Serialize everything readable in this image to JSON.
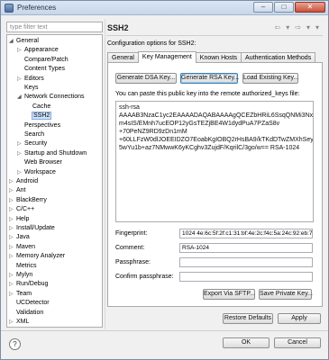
{
  "window": {
    "title": "Preferences",
    "controls": [
      "–",
      "□",
      "✕"
    ]
  },
  "filter": {
    "placeholder": "type filter text"
  },
  "tree": [
    {
      "label": "General",
      "toggle": "◢",
      "indent": 0
    },
    {
      "label": "Appearance",
      "toggle": "▷",
      "indent": 1
    },
    {
      "label": "Compare/Patch",
      "toggle": "",
      "indent": 1
    },
    {
      "label": "Content Types",
      "toggle": "",
      "indent": 1
    },
    {
      "label": "Editors",
      "toggle": "▷",
      "indent": 1
    },
    {
      "label": "Keys",
      "toggle": "",
      "indent": 1
    },
    {
      "label": "Network Connections",
      "toggle": "◢",
      "indent": 1
    },
    {
      "label": "Cache",
      "toggle": "",
      "indent": 2
    },
    {
      "label": "SSH2",
      "toggle": "",
      "indent": 2,
      "selected": true
    },
    {
      "label": "Perspectives",
      "toggle": "",
      "indent": 1
    },
    {
      "label": "Search",
      "toggle": "",
      "indent": 1
    },
    {
      "label": "Security",
      "toggle": "▷",
      "indent": 1
    },
    {
      "label": "Startup and Shutdown",
      "toggle": "▷",
      "indent": 1
    },
    {
      "label": "Web Browser",
      "toggle": "",
      "indent": 1
    },
    {
      "label": "Workspace",
      "toggle": "▷",
      "indent": 1
    },
    {
      "label": "Android",
      "toggle": "▷",
      "indent": 0
    },
    {
      "label": "Ant",
      "toggle": "▷",
      "indent": 0
    },
    {
      "label": "BlackBerry",
      "toggle": "▷",
      "indent": 0
    },
    {
      "label": "C/C++",
      "toggle": "▷",
      "indent": 0
    },
    {
      "label": "Help",
      "toggle": "▷",
      "indent": 0
    },
    {
      "label": "Install/Update",
      "toggle": "▷",
      "indent": 0
    },
    {
      "label": "Java",
      "toggle": "▷",
      "indent": 0
    },
    {
      "label": "Maven",
      "toggle": "▷",
      "indent": 0
    },
    {
      "label": "Memory Analyzer",
      "toggle": "▷",
      "indent": 0
    },
    {
      "label": "Metrics",
      "toggle": "",
      "indent": 0
    },
    {
      "label": "Mylyn",
      "toggle": "▷",
      "indent": 0
    },
    {
      "label": "Run/Debug",
      "toggle": "▷",
      "indent": 0
    },
    {
      "label": "Team",
      "toggle": "▷",
      "indent": 0
    },
    {
      "label": "UCDetector",
      "toggle": "",
      "indent": 0
    },
    {
      "label": "Validation",
      "toggle": "",
      "indent": 0
    },
    {
      "label": "XML",
      "toggle": "▷",
      "indent": 0
    }
  ],
  "page": {
    "title": "SSH2",
    "nav": [
      "⇦",
      "▾",
      "⇨",
      "▾",
      "▾"
    ],
    "description": "Configuration options for SSH2:"
  },
  "tabs": [
    "General",
    "Key Management",
    "Known Hosts",
    "Authentication Methods"
  ],
  "key_mgmt": {
    "gen_dsa": "Generate DSA Key...",
    "gen_rsa": "Generate RSA Key...",
    "load_existing": "Load Existing Key...",
    "paste_label": "You can paste this public key into the remote authorized_keys file:",
    "public_key_lines": [
      "ssh-rsa",
      "AAAAB3NzaC1yc2EAAAADAQABAAAAgQCEZbHRiL6SsqQNMi3Nx",
      "m4sIS/EMnh7ucEOP12yGsTEZjBE4W1dydPuA7PZaS8v",
      "+70PeNZ9RD9zDn1mM",
      "+60LLFzW0dlJOEEIDZO7EoabKgIOBQ2rHsBA9/kTKdDTwZMXhSey",
      "5wYu1b+az7NMwwK6yKCghv3ZujdF/KqrilC/3go/w== RSA-1024"
    ],
    "fingerprint_label": "Fingerprint:",
    "fingerprint_value": "1024 4e:6c:5f:2f:c1:31:bf:4e:2c:f4c:5a:24c:92:eb:7a",
    "comment_label": "Comment:",
    "comment_value": "RSA-1024",
    "passphrase_label": "Passphrase:",
    "passphrase_value": "",
    "confirm_label": "Confirm passphrase:",
    "confirm_value": "",
    "export_via_sftp": "Export Via SFTP...",
    "save_private_key": "Save Private Key..."
  },
  "footer": {
    "restore_defaults": "Restore Defaults",
    "apply": "Apply",
    "ok": "OK",
    "cancel": "Cancel",
    "help_icon": "?"
  }
}
